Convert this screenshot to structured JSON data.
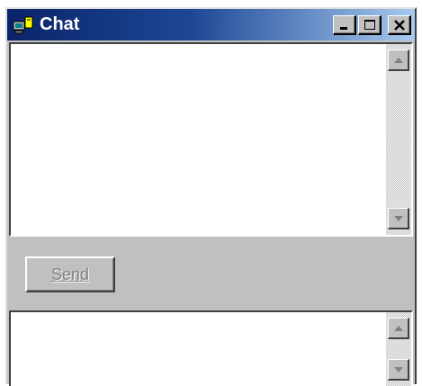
{
  "window": {
    "title": "Chat",
    "icon": "app-computer-icon",
    "controls": {
      "minimize": "minimize-icon",
      "maximize": "maximize-icon",
      "close": "close-icon"
    }
  },
  "toolbar": {
    "send_label": "Send",
    "send_enabled": false
  },
  "colors": {
    "title_bar_start": "#0a246a",
    "title_bar_end": "#a6caf0",
    "face": "#c0c0c0",
    "disabled_text": "#808080"
  }
}
